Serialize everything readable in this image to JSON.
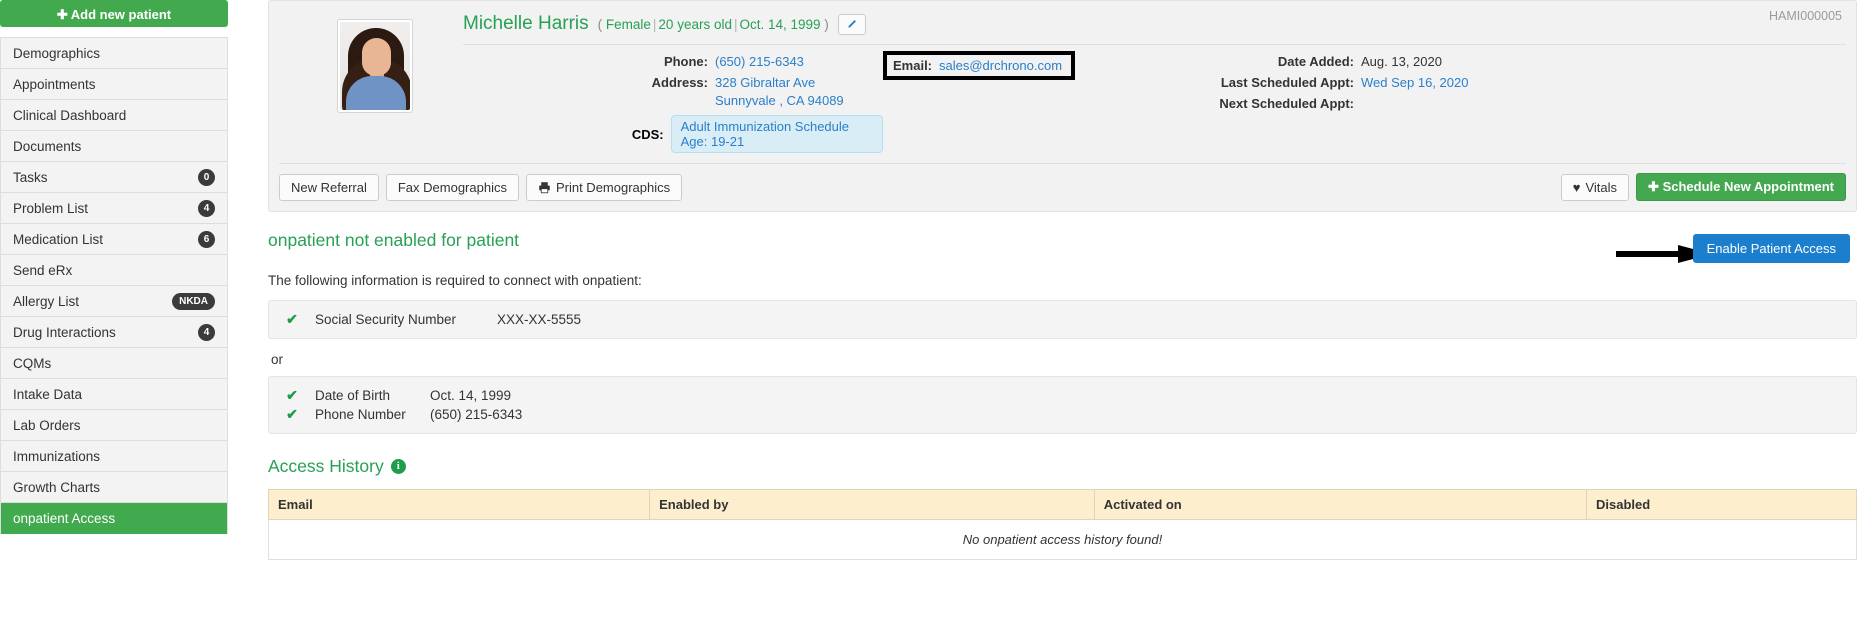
{
  "sidebar": {
    "add_patient_label": "Add new patient",
    "items": [
      {
        "label": "Demographics",
        "badge": null,
        "active": false
      },
      {
        "label": "Appointments",
        "badge": null,
        "active": false
      },
      {
        "label": "Clinical Dashboard",
        "badge": null,
        "active": false
      },
      {
        "label": "Documents",
        "badge": null,
        "active": false
      },
      {
        "label": "Tasks",
        "badge": "0",
        "active": false
      },
      {
        "label": "Problem List",
        "badge": "4",
        "active": false
      },
      {
        "label": "Medication List",
        "badge": "6",
        "active": false
      },
      {
        "label": "Send eRx",
        "badge": null,
        "active": false
      },
      {
        "label": "Allergy List",
        "badge": "NKDA",
        "active": false
      },
      {
        "label": "Drug Interactions",
        "badge": "4",
        "active": false
      },
      {
        "label": "CQMs",
        "badge": null,
        "active": false
      },
      {
        "label": "Intake Data",
        "badge": null,
        "active": false
      },
      {
        "label": "Lab Orders",
        "badge": null,
        "active": false
      },
      {
        "label": "Immunizations",
        "badge": null,
        "active": false
      },
      {
        "label": "Growth Charts",
        "badge": null,
        "active": false
      },
      {
        "label": "onpatient Access",
        "badge": null,
        "active": true
      }
    ]
  },
  "patient": {
    "chart_id": "HAMI000005",
    "name": "Michelle Harris",
    "gender": "Female",
    "age": "20 years old",
    "dob": "Oct. 14, 1999",
    "phone_label": "Phone:",
    "phone": "(650) 215-6343",
    "address_label": "Address:",
    "address_line1": "328 Gibraltar Ave",
    "address_line2": "Sunnyvale , CA 94089",
    "email_label": "Email:",
    "email": "sales@drchrono.com",
    "cds_label": "CDS:",
    "cds_value": "Adult Immunization Schedule Age: 19-21",
    "date_added_label": "Date Added:",
    "date_added": "Aug. 13, 2020",
    "last_appt_label": "Last Scheduled Appt:",
    "last_appt": "Wed Sep 16, 2020",
    "next_appt_label": "Next Scheduled Appt:",
    "next_appt": ""
  },
  "actions": {
    "new_referral": "New Referral",
    "fax_demographics": "Fax Demographics",
    "print_demographics": "Print Demographics",
    "vitals": "Vitals",
    "schedule_new_appointment": "Schedule New Appointment"
  },
  "onpatient": {
    "title": "onpatient not enabled for patient",
    "enable_button": "Enable Patient Access",
    "subtitle": "The following information is required to connect with onpatient:",
    "group1": [
      {
        "name": "Social Security Number",
        "value": "XXX-XX-5555",
        "checked": true
      }
    ],
    "or_text": "or",
    "group2": [
      {
        "name": "Date of Birth",
        "value": "Oct. 14, 1999",
        "checked": true
      },
      {
        "name": "Phone Number",
        "value": "(650) 215-6343",
        "checked": true
      }
    ]
  },
  "access_history": {
    "title": "Access History",
    "columns": [
      "Email",
      "Enabled by",
      "Activated on",
      "Disabled"
    ],
    "empty_message": "No onpatient access history found!"
  },
  "colors": {
    "brand_green": "#27a154",
    "link_blue": "#2a7fc9",
    "primary_blue": "#1b7fce",
    "table_header": "#fdeece"
  }
}
